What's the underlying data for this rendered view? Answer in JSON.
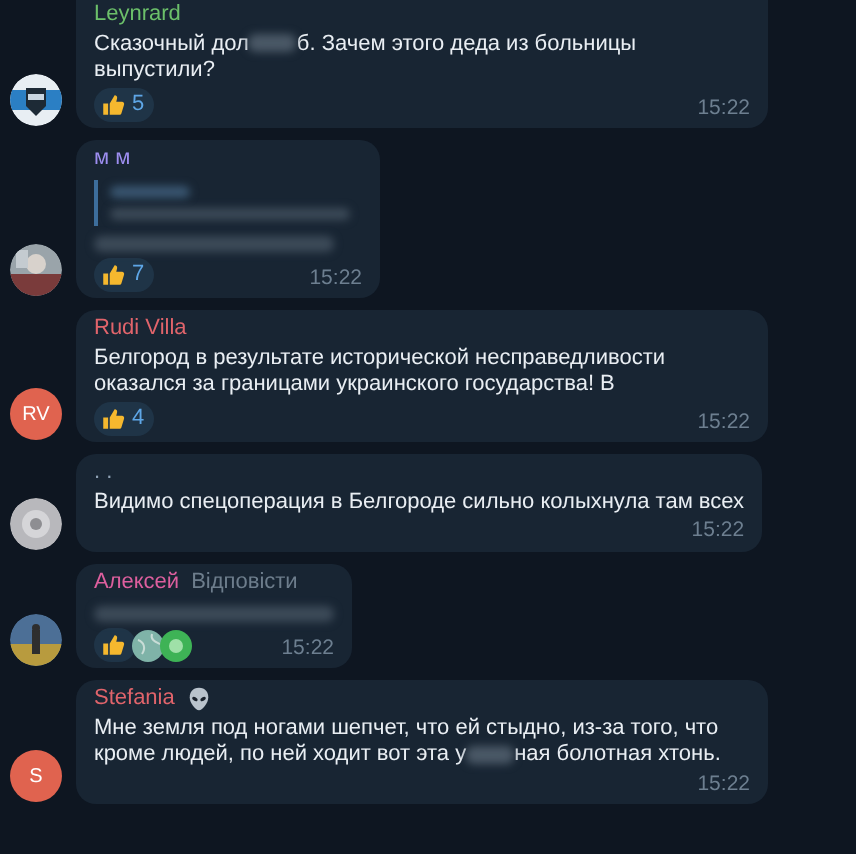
{
  "messages": [
    {
      "author": "Leynrard",
      "color": "#6cc06a",
      "parts": [
        {
          "kind": "text",
          "text": "Сказочный дол"
        },
        {
          "kind": "blur"
        },
        {
          "kind": "text",
          "text": "б. Зачем этого деда из больницы выпустили?"
        }
      ],
      "reactions": [
        {
          "kind": "thumb",
          "count": "5"
        }
      ],
      "time": "15:22"
    },
    {
      "author": "м м",
      "color": "#9d8ef0",
      "quote": {
        "kind": "blur"
      },
      "parts": [
        {
          "kind": "blur_line"
        }
      ],
      "reactions": [
        {
          "kind": "thumb",
          "count": "7"
        }
      ],
      "time": "15:22"
    },
    {
      "author": "Rudi Villa",
      "color": "#e0646b",
      "avatar": {
        "kind": "initials",
        "text": "RV",
        "color": "#e0634f"
      },
      "parts": [
        {
          "kind": "text",
          "text": "Белгород в результате исторической несправедливости оказался за границами украинского государства! В"
        }
      ],
      "reactions": [
        {
          "kind": "thumb",
          "count": "4"
        }
      ],
      "time": "15:22"
    },
    {
      "author": ". .",
      "color": "#8fa2b5",
      "parts": [
        {
          "kind": "text",
          "text": "Видимо спецоперация в Белгороде сильно колыхнула там всех"
        }
      ],
      "time": "15:22"
    },
    {
      "author": "Алексей",
      "color": "#dd5f9e",
      "reply_link": "Відповісти",
      "parts": [
        {
          "kind": "blur_line"
        }
      ],
      "reactions": [
        {
          "kind": "thumb"
        },
        {
          "kind": "globe"
        },
        {
          "kind": "green"
        }
      ],
      "time": "15:22"
    },
    {
      "author": "Stefania",
      "color": "#e0646b",
      "badge": {
        "kind": "alien"
      },
      "avatar": {
        "kind": "initials",
        "text": "S",
        "color": "#e0634f"
      },
      "parts": [
        {
          "kind": "text",
          "text": "Мне земля под ногами шепчет, что ей стыдно, из-за того, что кроме людей, по ней ходит вот эта у"
        },
        {
          "kind": "blur"
        },
        {
          "kind": "text",
          "text": "ная болотная хтонь."
        }
      ],
      "time": "15:22"
    }
  ]
}
